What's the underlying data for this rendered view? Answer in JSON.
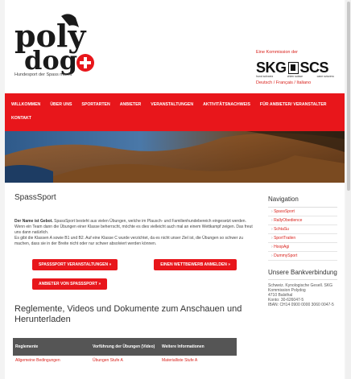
{
  "header": {
    "logo_line1": "poly",
    "logo_line2": "dog",
    "logo_subtitle": "Hundesport der Spass macht",
    "commission_label": "Eine Kommission der",
    "skg_text_left": "SKG",
    "skg_text_right": "SCS",
    "skg_tags": [
      "hund schweiz",
      "chien suisse",
      "cane svizzero"
    ],
    "languages": "Deutsch / Français / Italiano"
  },
  "nav": {
    "items": [
      "WILLKOMMEN",
      "ÜBER UNS",
      "SPORTARTEN",
      "ANBIETER",
      "VERANSTALTUNGEN",
      "AKTIVITÄTSNACHWEIS",
      "FÜR ANBIETER/ VERANSTALTER",
      "KONTAKT"
    ]
  },
  "main": {
    "title": "SpassSport",
    "intro_bold": "Der Name ist Gebot.",
    "intro_text": " SpassSport besteht aus vielen Übungen, welche im Plausch- und Familienhundebereich eingesetzt werden. Wenn ein Team dann die Übungen einer Klasse beherrscht, möchte es dies vielleicht auch mal an einem Wettkampf zeigen. Das freut uns dann natürlich.",
    "intro_text2": "Es gibt die Klassen A sowie B1 und B2. Auf eine Klasse C wurde verzichtet, da es nicht unser Ziel ist, die Übungen so schwer zu machen, dass sie in der Breite nicht oder nur schwer absolviert werden können.",
    "buttons": {
      "events": "SPASSSPORT VERANSTALTUNGEN »",
      "competition": "EINEN WETTBEWERB ANMELDEN »",
      "providers": "ANBIETER VON SPASSSPORT »"
    },
    "section_title": "Reglemente, Videos und Dokumente zum Anschauen und Herunterladen",
    "table": {
      "headers": [
        "Reglemente",
        "Vorführung der Übungen (Video)",
        "Weitere Informationen"
      ],
      "rows": [
        [
          "Allgemeine Bedingungen",
          "Übungen Stufe A",
          "Materialliste Stufe A"
        ]
      ]
    }
  },
  "sidebar": {
    "nav_title": "Navigation",
    "items": [
      "SpassSport",
      "RallyObedience",
      "SchtaSu",
      "SportTrailen",
      "HoopAgi",
      "DummySport"
    ],
    "bank_title": "Unsere Bankverbindung",
    "bank_lines": [
      "Schweiz. Kynologische Gesell. SKG",
      "Kommission Polydog",
      "4710 Balsthal",
      "Konto: 30-626047-5",
      "IBAN: CH14 0900 0000 3060 0047-5"
    ]
  },
  "colors": {
    "brand_red": "#e8161b",
    "table_header": "#555555"
  }
}
